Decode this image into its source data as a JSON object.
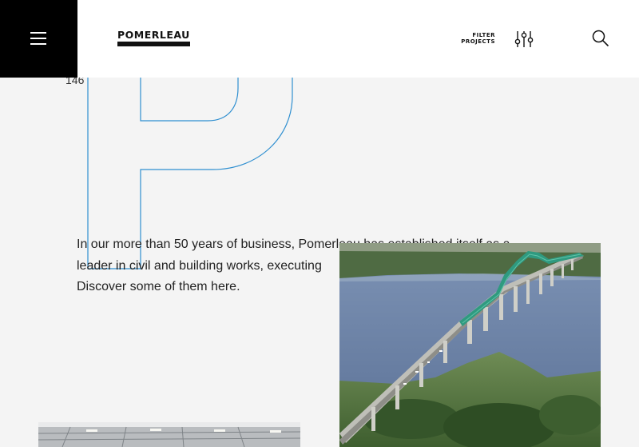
{
  "header": {
    "logo_text": "POMERLEAU",
    "filter_line1": "FILTER",
    "filter_line2": "PROJECTS"
  },
  "icons": {
    "menu": "hamburger-icon",
    "filter": "sliders-icon",
    "search": "search-icon"
  },
  "hero": {
    "letter": "P",
    "counter": "146"
  },
  "intro": {
    "line1": "In our more than 50 years of business, Pomerleau has established itself as a",
    "line2": "leader in civil and building works, executing",
    "line3": "Discover some of them here."
  },
  "colors": {
    "accent_blue": "#2f8fd0",
    "header_bg": "#ffffff",
    "menu_bg": "#000000",
    "page_bg": "#f4f4f4"
  }
}
